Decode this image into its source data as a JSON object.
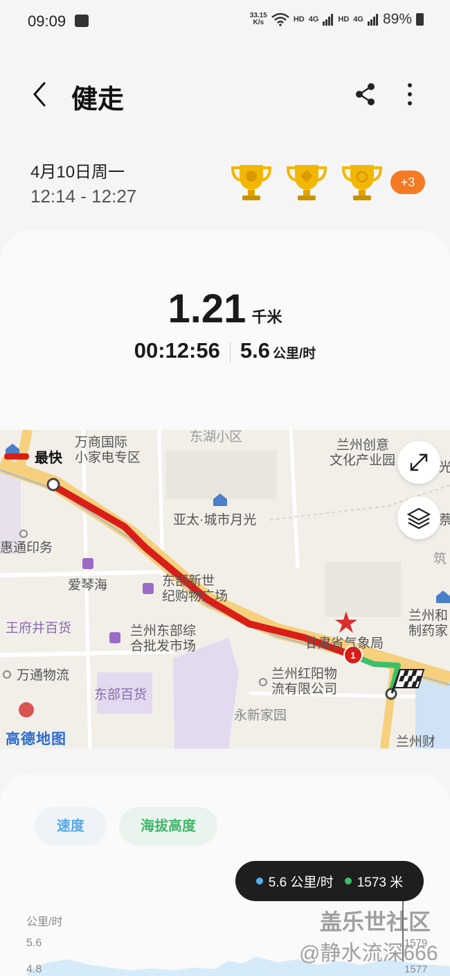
{
  "status_bar": {
    "time": "09:09",
    "net_speed_value": "33.15",
    "net_speed_unit": "K/s",
    "hd1": "HD",
    "sig1": "4G",
    "hd2": "HD",
    "sig2": "4G",
    "battery": "89%",
    "icons": [
      "image-icon",
      "wifi-icon",
      "signal-icon",
      "battery-icon"
    ]
  },
  "header": {
    "title": "健走",
    "icons": [
      "back-arrow-icon",
      "share-icon",
      "more-vertical-icon"
    ]
  },
  "session": {
    "date": "4月10日周一",
    "time_range": "12:14 - 12:27",
    "extra_badges": "+3",
    "trophy_colors": "#f2b705"
  },
  "summary": {
    "distance_value": "1.21",
    "distance_unit": "千米",
    "duration": "00:12:56",
    "speed_value": "5.6",
    "speed_unit": "公里/时"
  },
  "map": {
    "legend_label": "最快",
    "route_color": "#d91e18",
    "end_segment_color": "#3bbf6a",
    "marker_label": "1",
    "logo": "高德地图",
    "labels": {
      "l1": "万商国际",
      "l2": "小家电专区",
      "l3": "东湖小区",
      "l4": "兰州创意",
      "l5": "文化产业园",
      "l6": "亚太·城市月光",
      "l7": "惠通印务",
      "l8": "爱琴海",
      "l9": "东部新世",
      "l10": "纪购物广场",
      "l11": "王府井百货",
      "l12": "兰州东部综",
      "l13": "合批发市场",
      "l14": "甘肃省气象局",
      "l15": "兰州红阳物",
      "l16": "流有限公司",
      "l17": "万通物流",
      "l18": "东部百货",
      "l19": "永新家园",
      "l20": "兰州和",
      "l21": "制药家",
      "l22": "兰州财",
      "l23": "筑",
      "l24": "萘",
      "l25": "光"
    },
    "buttons": [
      "expand-icon",
      "layers-icon"
    ]
  },
  "chart": {
    "tabs": {
      "speed": "速度",
      "altitude": "海拔高度"
    },
    "tooltip_speed": "5.6 公里/时",
    "tooltip_alt": "1573 米",
    "speed_color": "#5ab0f0",
    "alt_color": "#3bbf6a",
    "unit_label": "公里/时",
    "ticks_left": [
      "5.6",
      "4.8"
    ],
    "ticks_right": [
      "1579",
      "1577"
    ]
  },
  "watermark": {
    "line1": "盖乐世社区",
    "line2": "@静水流深666"
  }
}
